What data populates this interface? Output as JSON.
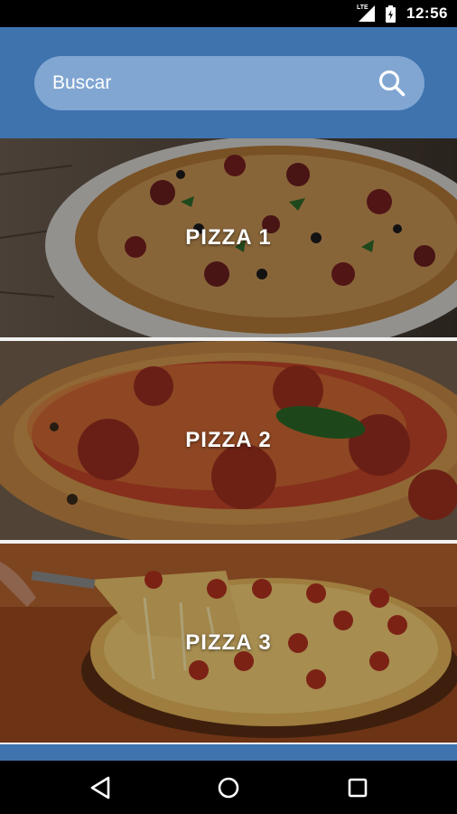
{
  "status_bar": {
    "network_label": "LTE",
    "time": "12:56",
    "icons": [
      "signal-icon",
      "battery-icon"
    ]
  },
  "search": {
    "placeholder": "Buscar",
    "value": "",
    "icon": "search-icon"
  },
  "pizzas": [
    {
      "label": "PIZZA 1"
    },
    {
      "label": "PIZZA 2"
    },
    {
      "label": "PIZZA 3"
    }
  ],
  "nav_bar": {
    "icons": [
      "back-icon",
      "home-icon",
      "recents-icon"
    ]
  },
  "colors": {
    "header": "#3e73ae",
    "search_box": "#81a6d2",
    "label_text": "#ffffff"
  }
}
